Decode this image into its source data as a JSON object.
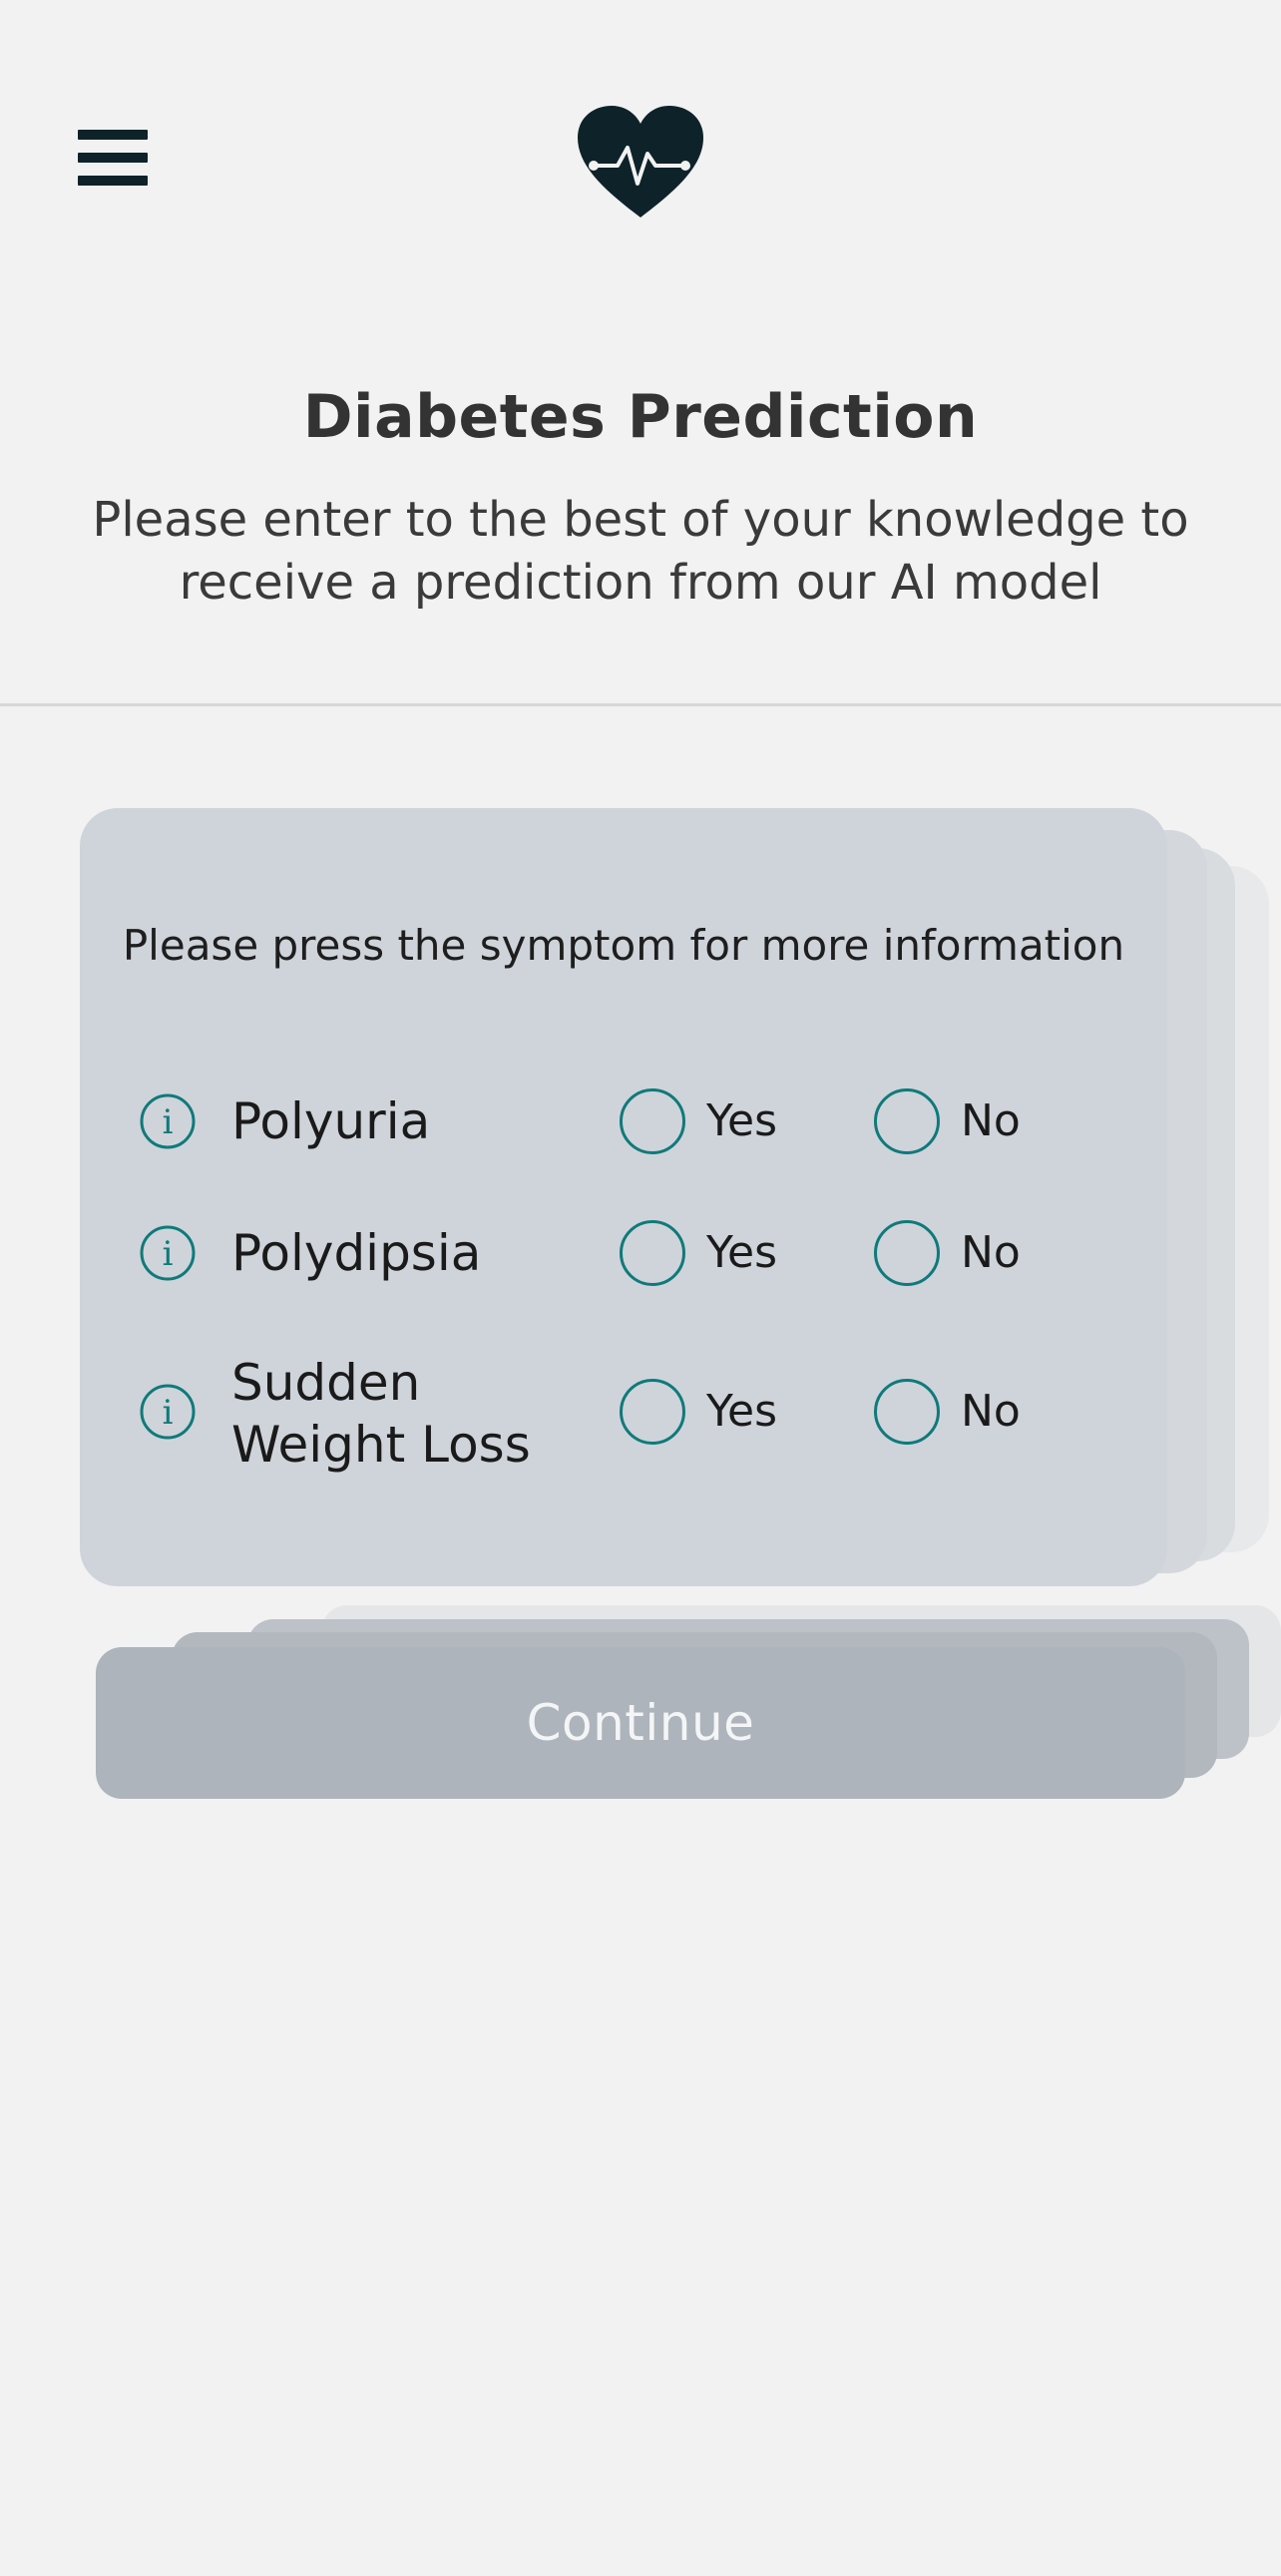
{
  "header": {
    "menu_icon": "hamburger-menu-icon",
    "logo_icon": "heart-pulse-icon",
    "title": "Diabetes Prediction",
    "subtitle": "Please enter to the best of your knowledge to receive a prediction from our AI model"
  },
  "card": {
    "hint": "Please press the symptom for more information",
    "info_icon": "info-icon",
    "rows": [
      {
        "symptom": "Polyuria",
        "yes_label": "Yes",
        "no_label": "No"
      },
      {
        "symptom": "Polydipsia",
        "yes_label": "Yes",
        "no_label": "No"
      },
      {
        "symptom_line1": "Sudden",
        "symptom_line2": "Weight Loss",
        "yes_label": "Yes",
        "no_label": "No"
      }
    ]
  },
  "continue_label": "Continue",
  "colors": {
    "background": "#f2f2f2",
    "card": "#cfd4da",
    "accent": "#0f7a7a",
    "button": "#adb4bb",
    "logo": "#0e2229"
  }
}
